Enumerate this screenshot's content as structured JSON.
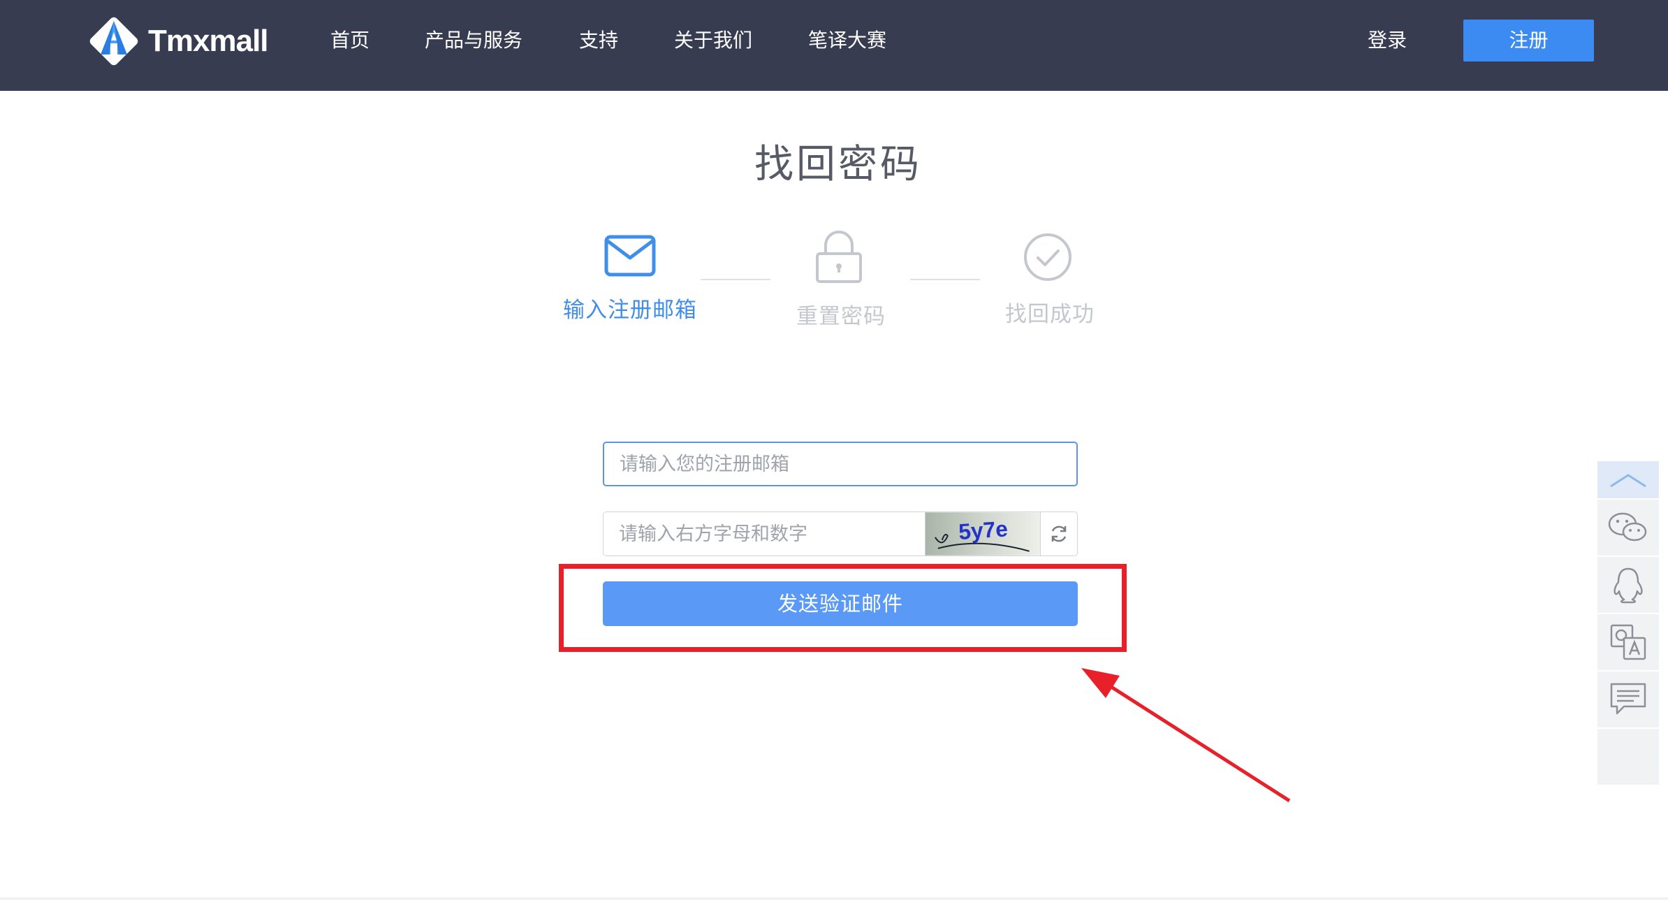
{
  "header": {
    "brand": "Tmxmall",
    "nav": [
      {
        "label": "首页"
      },
      {
        "label": "产品与服务"
      },
      {
        "label": "支持"
      },
      {
        "label": "关于我们"
      },
      {
        "label": "笔译大赛"
      }
    ],
    "login_label": "登录",
    "register_label": "注册"
  },
  "page_title": "找回密码",
  "steps": [
    {
      "label": "输入注册邮箱",
      "icon": "envelope-icon",
      "state": "active"
    },
    {
      "label": "重置密码",
      "icon": "lock-icon",
      "state": "inactive"
    },
    {
      "label": "找回成功",
      "icon": "check-circle-icon",
      "state": "inactive"
    }
  ],
  "form": {
    "email_placeholder": "请输入您的注册邮箱",
    "captcha_placeholder": "请输入右方字母和数字",
    "captcha_code": "5y7e",
    "submit_label": "发送验证邮件"
  },
  "floatbar": {
    "items": [
      "chevron-up-icon",
      "wechat-icon",
      "qq-icon",
      "qa-icon",
      "message-icon"
    ]
  },
  "colors": {
    "header_bg": "#383c51",
    "accent": "#3c8bf2",
    "step_active": "#3f8ee9",
    "step_inactive": "#c4c7cd",
    "annotation": "#e8202a"
  }
}
